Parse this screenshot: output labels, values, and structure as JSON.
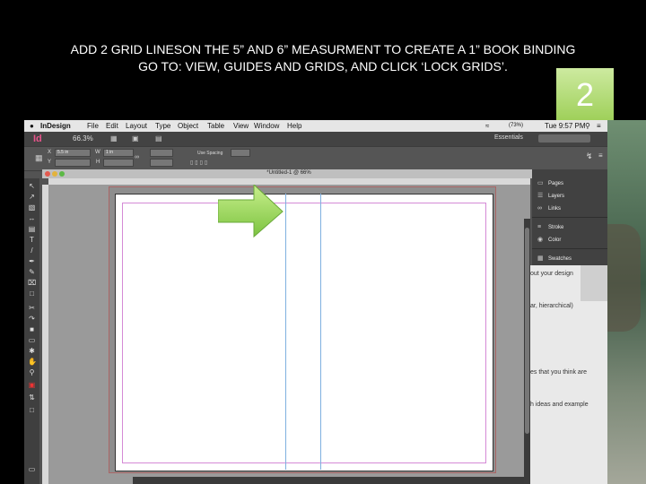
{
  "slide": {
    "instruction_line1": "ADD 2 GRID LINESON THE 5” AND 6” MEASURMENT TO CREATE A 1” BOOK BINDING",
    "instruction_line2": "GO TO: VIEW, GUIDES AND GRIDS, AND CLICK ‘LOCK GRIDS’.",
    "step_number": "2"
  },
  "menubar": {
    "items": [
      "InDesign",
      "File",
      "Edit",
      "Layout",
      "Type",
      "Object",
      "Table",
      "View",
      "Window",
      "Help"
    ],
    "battery": "(73%)",
    "clock": "Tue 9:57 PM"
  },
  "appbar": {
    "logo": "Id",
    "zoom": "66.3%",
    "workspace": "Essentials"
  },
  "controlbar": {
    "x_value": "5.5 in",
    "w_label": "W",
    "w_value": "1 in",
    "use_spacing": "Use Spacing"
  },
  "document": {
    "tab_title": "*Untitled-1 @ 66%"
  },
  "panels": {
    "items": [
      {
        "icon": "pages-icon",
        "label": "Pages"
      },
      {
        "icon": "layers-icon",
        "label": "Layers"
      },
      {
        "icon": "links-icon",
        "label": "Links"
      },
      {
        "icon": "stroke-icon",
        "label": "Stroke"
      },
      {
        "icon": "color-icon",
        "label": "Color"
      },
      {
        "icon": "swatches-icon",
        "label": "Swatches"
      }
    ]
  },
  "background_doc": {
    "lines": [
      "out your design",
      "ar, hierarchical)",
      "es that you think are",
      "h ideas and example"
    ]
  },
  "colors": {
    "badge": "#9fd05a",
    "arrow": "#8ccf4e",
    "guide": "#7fb0e0",
    "margin": "#d58ad6",
    "indesign_logo": "#e8548b"
  }
}
